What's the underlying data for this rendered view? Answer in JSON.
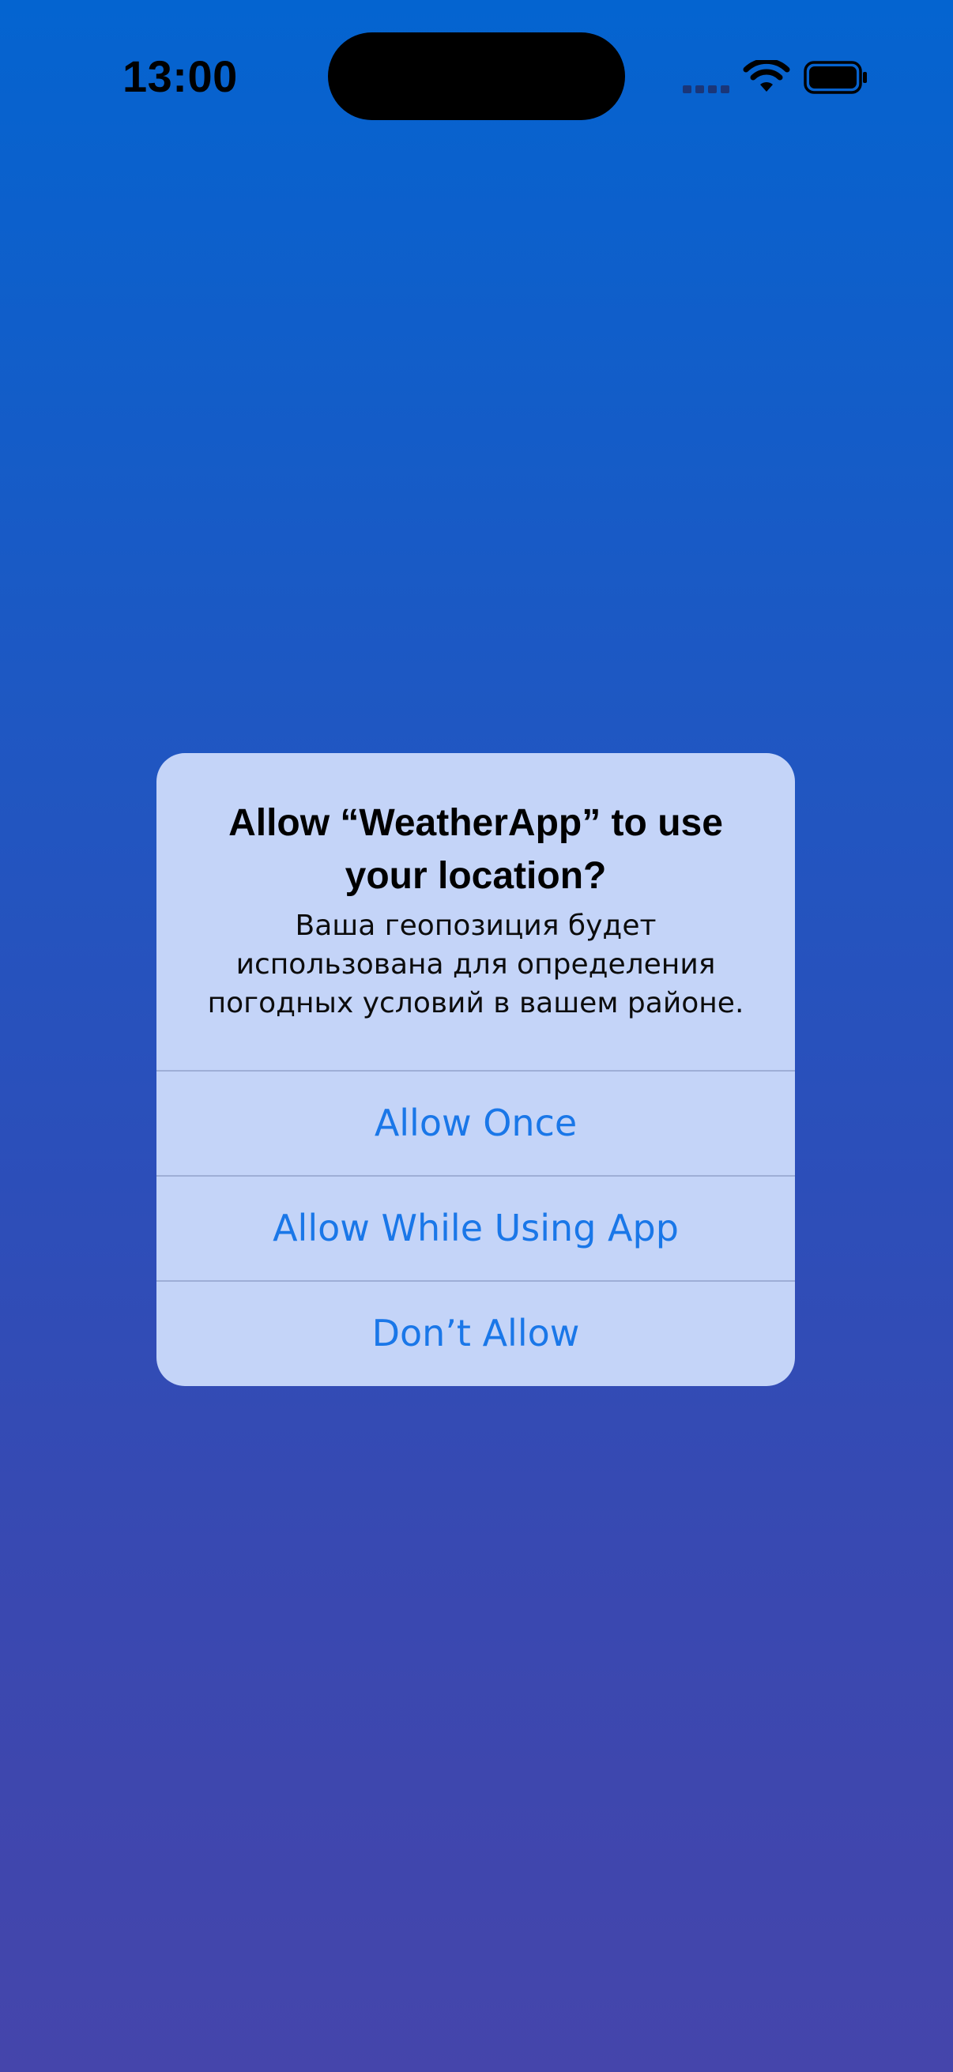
{
  "status_bar": {
    "time": "13:00",
    "signal_icon": "cellular-signal-icon",
    "wifi_icon": "wifi-icon",
    "battery_icon": "battery-icon"
  },
  "alert": {
    "title": "Allow “WeatherApp” to use your location?",
    "message": "Ваша геопозиция будет использована для определения погодных условий в вашем районе.",
    "buttons": {
      "allow_once": "Allow Once",
      "allow_while_using": "Allow While Using App",
      "dont_allow": "Don’t Allow"
    }
  },
  "colors": {
    "background_top": "#0464d0",
    "background_bottom": "#4545ab",
    "alert_background": "#c4d4f8",
    "button_text": "#1a77e8"
  }
}
